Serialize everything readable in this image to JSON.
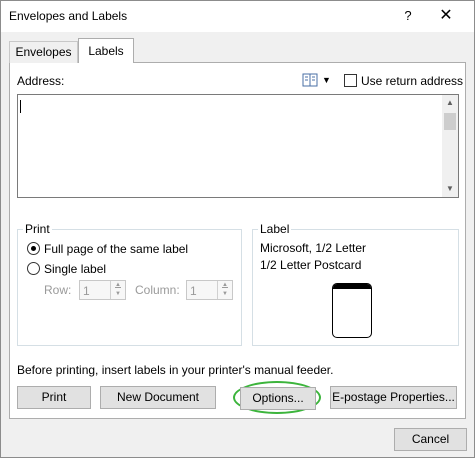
{
  "window": {
    "title": "Envelopes and Labels",
    "help_glyph": "?",
    "close_glyph": "✕"
  },
  "tabs": [
    {
      "label": "Envelopes",
      "active": false
    },
    {
      "label": "Labels",
      "active": true
    }
  ],
  "address": {
    "label": "Address:",
    "value": "",
    "use_return_address": {
      "label": "Use return address",
      "checked": false
    }
  },
  "print_group": {
    "title": "Print",
    "options": [
      {
        "label": "Full page of the same label",
        "selected": true
      },
      {
        "label": "Single label",
        "selected": false
      }
    ],
    "row": {
      "label": "Row:",
      "value": "1"
    },
    "column": {
      "label": "Column:",
      "value": "1"
    }
  },
  "label_group": {
    "title": "Label",
    "vendor": "Microsoft, 1/2 Letter",
    "product": "1/2 Letter Postcard"
  },
  "notice": "Before printing, insert labels in your printer's manual feeder.",
  "buttons": {
    "print": "Print",
    "new_document": "New Document",
    "options": "Options...",
    "epostage": "E-postage Properties...",
    "cancel": "Cancel"
  },
  "colors": {
    "highlight": "#3cb43c"
  }
}
